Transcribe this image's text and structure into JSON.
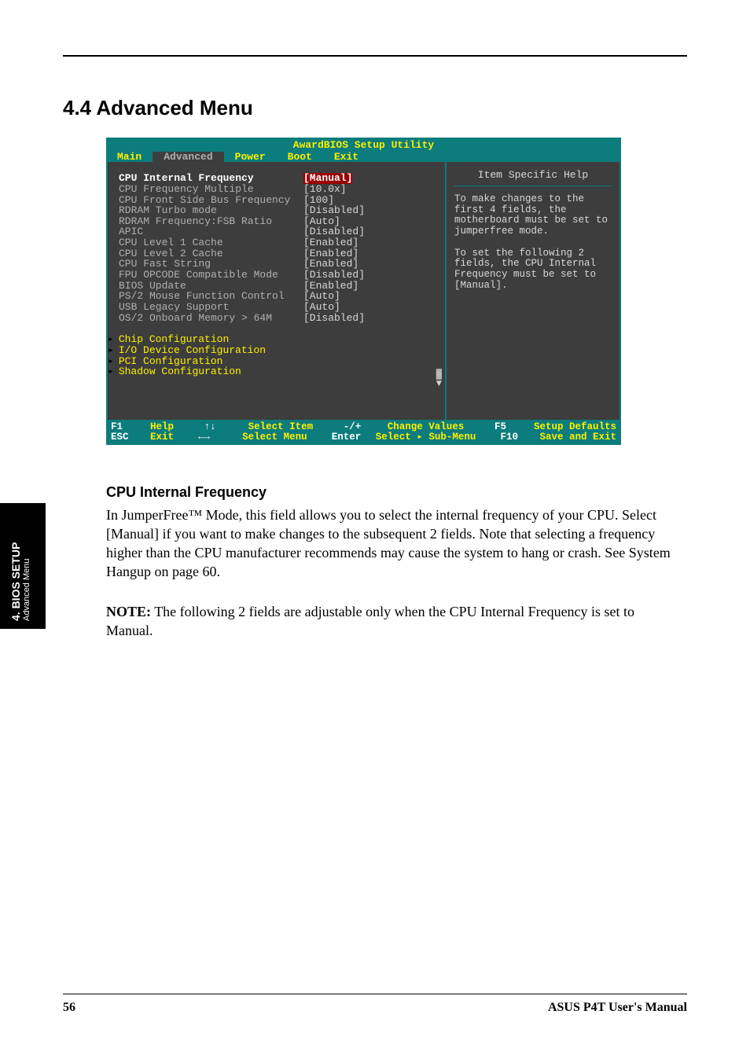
{
  "section_title": "4.4 Advanced Menu",
  "bios": {
    "title": "AwardBIOS Setup Utility",
    "tabs": [
      "Main",
      "Advanced",
      "Power",
      "Boot",
      "Exit"
    ],
    "active_tab": "Advanced",
    "items": [
      {
        "label": "CPU Internal Frequency",
        "value": "[Manual]",
        "selected": true
      },
      {
        "label": "CPU Frequency Multiple",
        "value": "[10.0x]"
      },
      {
        "label": "CPU Front Side Bus Frequency",
        "value": "[100]"
      },
      {
        "label": "RDRAM Turbo mode",
        "value": "[Disabled]"
      },
      {
        "label": "RDRAM Frequency:FSB Ratio",
        "value": "[Auto]"
      },
      {
        "label": "APIC",
        "value": "[Disabled]"
      },
      {
        "label": "CPU Level 1 Cache",
        "value": "[Enabled]"
      },
      {
        "label": "CPU Level 2 Cache",
        "value": "[Enabled]"
      },
      {
        "label": "CPU Fast String",
        "value": "[Enabled]"
      },
      {
        "label": "FPU OPCODE Compatible Mode",
        "value": "[Disabled]"
      },
      {
        "label": "BIOS Update",
        "value": "[Enabled]"
      },
      {
        "label": "PS/2 Mouse Function Control",
        "value": "[Auto]"
      },
      {
        "label": "USB Legacy Support",
        "value": "[Auto]"
      },
      {
        "label": "OS/2 Onboard Memory > 64M",
        "value": "[Disabled]"
      }
    ],
    "submenus": [
      "Chip Configuration",
      "I/O Device Configuration",
      "PCI Configuration",
      "Shadow Configuration"
    ],
    "help": {
      "title": "Item Specific Help",
      "text": "To make changes to the first 4 fields, the motherboard must be set to jumperfree mode.\n\nTo set the following 2 fields, the CPU Internal Frequency must be set to [Manual]."
    },
    "footer": {
      "r1": [
        {
          "key": "F1",
          "label": "Help"
        },
        {
          "sym": "↑↓",
          "label": "Select Item"
        },
        {
          "sym": "-/+",
          "label": "Change Values"
        },
        {
          "key": "F5",
          "label": "Setup Defaults"
        }
      ],
      "r2": [
        {
          "key": "ESC",
          "label": "Exit"
        },
        {
          "sym": "←→",
          "label": "Select Menu"
        },
        {
          "sym": "Enter",
          "label": "Select ▸ Sub-Menu"
        },
        {
          "key": "F10",
          "label": "Save and Exit"
        }
      ]
    }
  },
  "field": {
    "heading": "CPU Internal Frequency",
    "p1": "In JumperFree™ Mode, this field allows you to select the internal frequency of your CPU. Select [Manual] if you want to make changes to the subsequent 2 fields. Note that selecting a frequency higher than the CPU manufacturer recommends may cause the system to hang or crash. See System Hangup on page 60."
  },
  "note": {
    "label": "NOTE:",
    "text": " The following 2 fields are adjustable only when the CPU Internal Frequency is set to Manual."
  },
  "side_tab": {
    "main": "4. BIOS SETUP",
    "sub": "Advanced Menu"
  },
  "footer_page": {
    "page_num": "56",
    "manual": "ASUS P4T User's Manual"
  }
}
